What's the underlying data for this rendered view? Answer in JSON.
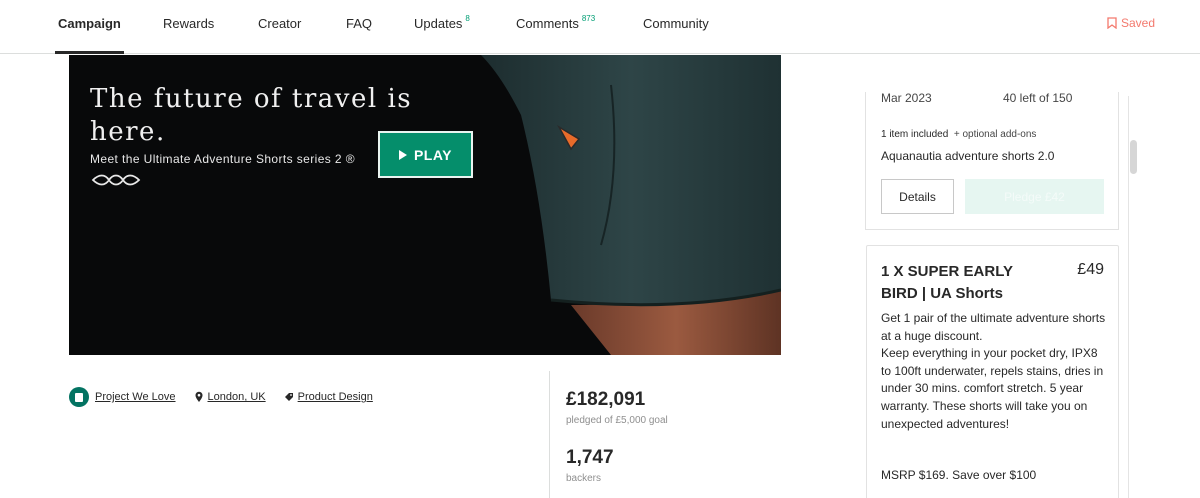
{
  "nav": {
    "tabs": [
      {
        "label": "Campaign",
        "count": ""
      },
      {
        "label": "Rewards",
        "count": ""
      },
      {
        "label": "Creator",
        "count": ""
      },
      {
        "label": "FAQ",
        "count": ""
      },
      {
        "label": "Updates",
        "count": "8"
      },
      {
        "label": "Comments",
        "count": "873"
      },
      {
        "label": "Community",
        "count": ""
      }
    ],
    "active_tab": "Campaign",
    "saved_label": "Saved",
    "saved_icon": "bookmark-icon",
    "accent_color": "#f3796d"
  },
  "video": {
    "headline": "The future of travel is here.",
    "subline": "Meet the Ultimate Adventure Shorts series 2 ®",
    "play_label": "PLAY",
    "play_icon": "play-icon",
    "button_color": "#058e6b"
  },
  "meta": {
    "badge_label": "Project We Love",
    "location": "London, UK",
    "category": "Product Design"
  },
  "stats": {
    "pledged": "£182,091",
    "pledged_label": "pledged of £5,000 goal",
    "backers": "1,747",
    "backers_label": "backers"
  },
  "reward_card_1": {
    "delivery": "Mar 2023",
    "remaining": "40 left of 150",
    "items_included": "1 item included",
    "addons": "+ optional add-ons",
    "item_name": "Aquanautia adventure shorts 2.0",
    "details_label": "Details",
    "pledge_label": "Pledge £42"
  },
  "reward_card_2": {
    "title": "1 X SUPER EARLY BIRD | UA Shorts",
    "price": "£49",
    "description": [
      "Get 1 pair of the ultimate adventure shorts at a huge discount.",
      "Keep everything in your pocket dry, IPX8 to 100ft underwater, repels stains, dries in under 30 mins. comfort stretch. 5 year warranty. These shorts will take you on unexpected adventures!"
    ],
    "msrp": "MSRP $169. Save over $100"
  }
}
